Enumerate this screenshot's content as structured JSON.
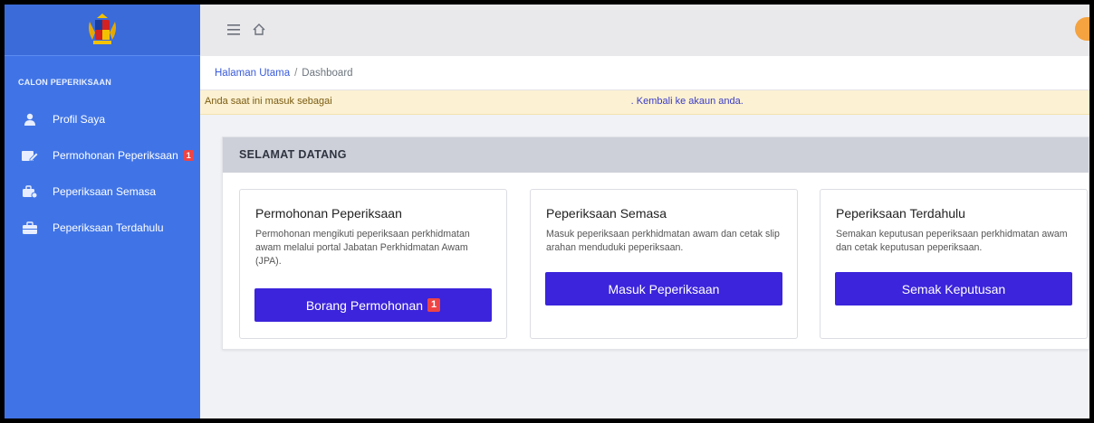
{
  "sidebar": {
    "logo_icon": "coat-of-arms-logo",
    "section_title": "CALON PEPERIKSAAN",
    "items": [
      {
        "label": "Profil Saya",
        "icon": "user-icon"
      },
      {
        "label": "Permohonan Peperiksaan",
        "icon": "edit-form-icon",
        "badge": "1"
      },
      {
        "label": "Peperiksaan Semasa",
        "icon": "exam-current-icon"
      },
      {
        "label": "Peperiksaan Terdahulu",
        "icon": "briefcase-icon"
      }
    ]
  },
  "topbar": {
    "menu_icon": "hamburger-menu-icon",
    "home_icon": "home-icon"
  },
  "breadcrumb": {
    "home": "Halaman Utama",
    "separator": "/",
    "current": "Dashboard"
  },
  "impersonate": {
    "prefix": "Anda saat ini masuk sebagai",
    "link": ". Kembali ke akaun anda."
  },
  "welcome": {
    "title": "SELAMAT DATANG",
    "cards": [
      {
        "title": "Permohonan Peperiksaan",
        "description": "Permohonan mengikuti peperiksaan perkhidmatan awam melalui portal Jabatan Perkhidmatan Awam (JPA).",
        "button": "Borang Permohonan",
        "badge": "1"
      },
      {
        "title": "Peperiksaan Semasa",
        "description": "Masuk peperiksaan perkhidmatan awam dan cetak slip arahan menduduki peperiksaan.",
        "button": "Masuk Peperiksaan"
      },
      {
        "title": "Peperiksaan Terdahulu",
        "description": "Semakan keputusan peperiksaan perkhidmatan awam dan cetak keputusan peperiksaan.",
        "button": "Semak Keputusan"
      }
    ]
  },
  "colors": {
    "sidebar": "#4074e6",
    "primary_button": "#3b24db",
    "badge": "#ef4444",
    "alert_bg": "#fcf1d2"
  }
}
